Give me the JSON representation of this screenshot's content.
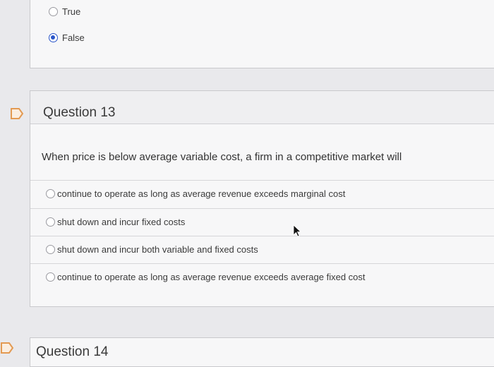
{
  "previous_question": {
    "options": [
      {
        "label": "True",
        "selected": false
      },
      {
        "label": "False",
        "selected": true
      }
    ]
  },
  "question13": {
    "title": "Question 13",
    "prompt": "When price is below average variable cost, a firm in a competitive market will",
    "options": [
      {
        "label": "continue to operate as long as average revenue exceeds marginal cost",
        "selected": false
      },
      {
        "label": "shut down and incur fixed costs",
        "selected": false
      },
      {
        "label": "shut down and incur both variable and fixed costs",
        "selected": false
      },
      {
        "label": "continue to operate as long as average revenue exceeds average fixed cost",
        "selected": false
      }
    ]
  },
  "question14": {
    "title": "Question 14"
  },
  "icons": {
    "flag": "flag-icon",
    "cursor": "mouse-pointer-icon"
  },
  "colors": {
    "accent": "#2b56c9",
    "background": "#e9e9ec",
    "card": "#f7f7f8"
  }
}
